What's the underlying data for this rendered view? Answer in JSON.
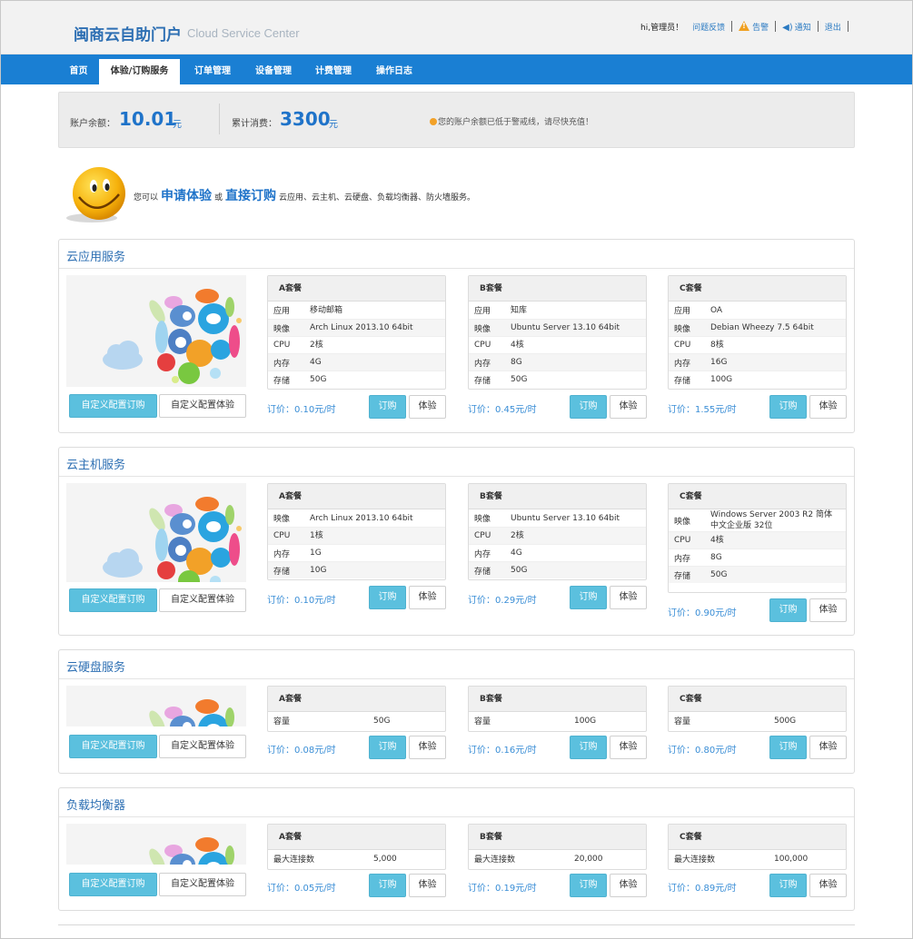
{
  "header": {
    "title": "闽商云自助门户",
    "subtitle": "Cloud Service Center",
    "greeting": "hi,管理员！",
    "feedback": "问题反馈",
    "alarm": "告警",
    "notice": "通知",
    "logout": "退出"
  },
  "nav": [
    "首页",
    "体验/订购服务",
    "订单管理",
    "设备管理",
    "计费管理",
    "操作日志"
  ],
  "nav_active": "体验/订购服务",
  "balance": {
    "balance_label": "账户余额：",
    "balance_value": "10.01",
    "balance_unit": "元",
    "spent_label": "累计消费：",
    "spent_value": "3300",
    "spent_unit": "元",
    "alert": "您的账户余额已低于警戒线，请尽快充值！"
  },
  "intro": {
    "prefix": "您可以",
    "trial": "申请体验",
    "or": "或",
    "order": "直接订购",
    "suffix": "云应用、云主机、云硬盘、负载均衡器、防火墙服务。"
  },
  "custom_order": "自定义配置订购",
  "custom_trial": "自定义配置体验",
  "order_btn": "订购",
  "trial_btn": "体验",
  "sections": [
    {
      "title": "云应用服务",
      "plans": [
        {
          "name": "A套餐",
          "rows": [
            [
              "应用",
              "移动邮箱"
            ],
            [
              "映像",
              "Arch Linux 2013.10 64bit"
            ],
            [
              "CPU",
              "2核"
            ],
            [
              "内存",
              "4G"
            ],
            [
              "存储",
              "50G"
            ]
          ],
          "price": "订价：0.10元/时"
        },
        {
          "name": "B套餐",
          "rows": [
            [
              "应用",
              "知库"
            ],
            [
              "映像",
              "Ubuntu Server 13.10 64bit"
            ],
            [
              "CPU",
              "4核"
            ],
            [
              "内存",
              "8G"
            ],
            [
              "存储",
              "50G"
            ]
          ],
          "price": "订价：0.45元/时"
        },
        {
          "name": "C套餐",
          "rows": [
            [
              "应用",
              "OA"
            ],
            [
              "映像",
              "Debian Wheezy 7.5 64bit"
            ],
            [
              "CPU",
              "8核"
            ],
            [
              "内存",
              "16G"
            ],
            [
              "存储",
              "100G"
            ]
          ],
          "price": "订价：1.55元/时"
        }
      ]
    },
    {
      "title": "云主机服务",
      "plans": [
        {
          "name": "A套餐",
          "rows": [
            [
              "映像",
              "Arch Linux 2013.10 64bit"
            ],
            [
              "CPU",
              "1核"
            ],
            [
              "内存",
              "1G"
            ],
            [
              "存储",
              "10G"
            ]
          ],
          "price": "订价：0.10元/时"
        },
        {
          "name": "B套餐",
          "rows": [
            [
              "映像",
              "Ubuntu Server 13.10 64bit"
            ],
            [
              "CPU",
              "2核"
            ],
            [
              "内存",
              "4G"
            ],
            [
              "存储",
              "50G"
            ]
          ],
          "price": "订价：0.29元/时"
        },
        {
          "name": "C套餐",
          "rows": [
            [
              "映像",
              "Windows Server 2003 R2 简体中文企业版 32位"
            ],
            [
              "CPU",
              "4核"
            ],
            [
              "内存",
              "8G"
            ],
            [
              "存储",
              "50G"
            ]
          ],
          "price": "订价：0.90元/时"
        }
      ]
    },
    {
      "title": "云硬盘服务",
      "plans": [
        {
          "name": "A套餐",
          "rows": [
            [
              "容量",
              "50G"
            ]
          ],
          "price": "订价：0.08元/时"
        },
        {
          "name": "B套餐",
          "rows": [
            [
              "容量",
              "100G"
            ]
          ],
          "price": "订价：0.16元/时"
        },
        {
          "name": "C套餐",
          "rows": [
            [
              "容量",
              "500G"
            ]
          ],
          "price": "订价：0.80元/时"
        }
      ]
    },
    {
      "title": "负载均衡器",
      "plans": [
        {
          "name": "A套餐",
          "rows": [
            [
              "最大连接数",
              "5,000"
            ]
          ],
          "price": "订价：0.05元/时"
        },
        {
          "name": "B套餐",
          "rows": [
            [
              "最大连接数",
              "20,000"
            ]
          ],
          "price": "订价：0.19元/时"
        },
        {
          "name": "C套餐",
          "rows": [
            [
              "最大连接数",
              "100,000"
            ]
          ],
          "price": "订价：0.89元/时"
        }
      ]
    }
  ]
}
